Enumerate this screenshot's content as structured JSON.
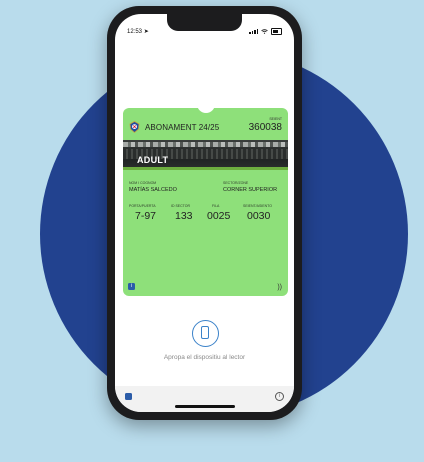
{
  "status_bar": {
    "time": "12:53",
    "location_glyph": "➤"
  },
  "pass": {
    "title": "ABONAMENT 24/25",
    "seat_label": "SEIENT",
    "seat_number": "360038",
    "category": "ADULT",
    "banner_note": "",
    "name_label": "NOM I COGNOM",
    "name_value": "MATÍAS SALCEDO",
    "section_label": "SECTOR/ZONE",
    "section_value": "CORNER SUPERIOR",
    "fields": [
      {
        "label": "PORTA/PUERTA",
        "value": "7-97"
      },
      {
        "label": "ID SECTOR",
        "value": "133"
      },
      {
        "label": "FILA",
        "value": "0025"
      },
      {
        "label": "SEIENT/ASIENTO",
        "value": "0030"
      }
    ],
    "info_glyph": "i",
    "nfc_glyph": "))"
  },
  "tap_prompt": "Apropa el dispositiu al lector",
  "bottom": {
    "info_glyph": "i"
  },
  "colors": {
    "background": "#b9dcec",
    "circle": "#22428f",
    "pass": "#8ee07a",
    "accent": "#3b82c9"
  },
  "icons": [
    "club-crest-icon",
    "info-icon",
    "nfc-icon",
    "phone-tap-icon"
  ]
}
